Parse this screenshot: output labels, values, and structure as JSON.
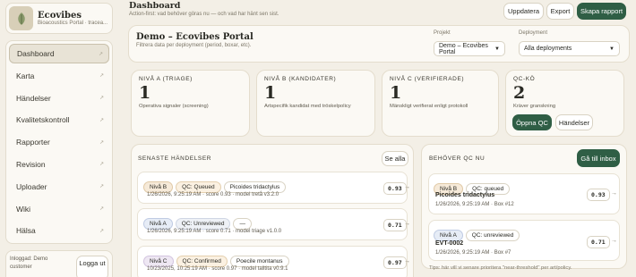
{
  "brand": {
    "name": "Ecovibes",
    "subtitle": "Bioacoustics Portal · tracea..."
  },
  "sidebar": {
    "items": [
      {
        "label": "Dashboard",
        "active": true
      },
      {
        "label": "Karta"
      },
      {
        "label": "Händelser"
      },
      {
        "label": "Kvalitetskontroll"
      },
      {
        "label": "Rapporter"
      },
      {
        "label": "Revision"
      },
      {
        "label": "Uploader"
      },
      {
        "label": "Wiki"
      },
      {
        "label": "Hälsa"
      }
    ],
    "arrow": "↗"
  },
  "footer": {
    "logged_in": "Inloggad: Demo",
    "role": "customer",
    "logout": "Logga ut"
  },
  "header": {
    "title": "Dashboard",
    "subtitle": "Action-first: vad behöver göras nu — och vad har hänt sen sist.",
    "update": "Uppdatera",
    "export": "Export",
    "create_report": "Skapa rapport"
  },
  "demo": {
    "title": "Demo – Ecovibes Portal",
    "subtitle": "Filtrera data per deployment (period, boxar, etc).",
    "project_label": "Projekt",
    "project_value": "Demo – Ecovibes Portal",
    "deployment_label": "Deployment",
    "deployment_value": "Alla deployments"
  },
  "kpis": [
    {
      "title": "NIVÅ A (TRIAGE)",
      "value": "1",
      "desc": "Operativa signaler (screening)"
    },
    {
      "title": "NIVÅ B (KANDIDATER)",
      "value": "1",
      "desc": "Artspecifik kandidat med tröskelpolicy"
    },
    {
      "title": "NIVÅ C (VERIFIERADE)",
      "value": "1",
      "desc": "Mänskligt verifierat enligt protokoll"
    },
    {
      "title": "QC-KÖ",
      "value": "2",
      "desc": "Kräver granskning",
      "open_qc": "Öppna QC",
      "events": "Händelser"
    }
  ],
  "events": {
    "title": "SENASTE HÄNDELSER",
    "see_all": "Se alla",
    "rows": [
      {
        "level": "Nivå B",
        "qc": "QC: Queued",
        "species": "Picoides tridactylus",
        "meta": "1/26/2026, 9:25:19 AM · score 0.93 · model tretå v3.2.0",
        "score": "0.93"
      },
      {
        "level": "Nivå A",
        "qc": "QC: Unreviewed",
        "species": "—",
        "meta": "1/26/2026, 9:25:19 AM · score 0.71 · model triage v1.0.0",
        "score": "0.71"
      },
      {
        "level": "Nivå C",
        "qc": "QC: Confirmed",
        "species": "Poecile montanus",
        "meta": "10/23/2025, 10:25:19 AM · score 0.97 · model talltita v0.9.1",
        "score": "0.97"
      }
    ]
  },
  "qc": {
    "title": "BEHÖVER QC NU",
    "goto_inbox": "Gå till inbox",
    "rows": [
      {
        "level": "Nivå B",
        "qc": "QC: queued",
        "name": "Picoides tridactylus",
        "meta": "1/26/2026, 9:25:19 AM · Box #12",
        "score": "0.93"
      },
      {
        "level": "Nivå A",
        "qc": "QC: unreviewed",
        "name": "EVT-0002",
        "meta": "1/26/2026, 9:25:19 AM · Box #7",
        "score": "0.71"
      }
    ],
    "tips": "Tips: här vill vi senare prioritera \"near-threshold\" per art/policy."
  },
  "colors": {
    "accent": "#2f5e45",
    "background": "#f3efe6"
  },
  "icons": {
    "logo": "leaf-logo-icon",
    "arrow": "arrow-up-right-icon",
    "caret": "chevron-down-icon"
  }
}
